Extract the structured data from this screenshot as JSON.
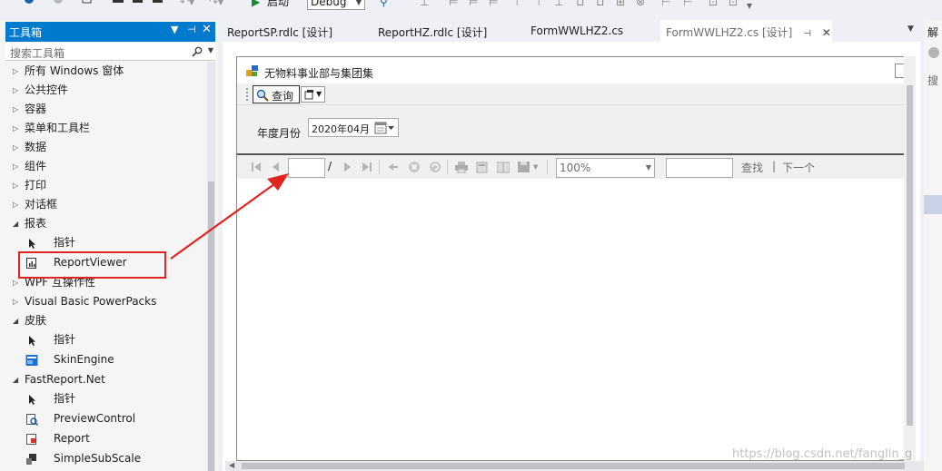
{
  "toolbar": {
    "start_label": "启动",
    "config_value": "Debug"
  },
  "toolbox": {
    "title": "工具箱",
    "search_placeholder": "搜索工具箱",
    "items": [
      {
        "label": "所有 Windows 窗体",
        "expander": "▷"
      },
      {
        "label": "公共控件",
        "expander": "▷"
      },
      {
        "label": "容器",
        "expander": "▷"
      },
      {
        "label": "菜单和工具栏",
        "expander": "▷"
      },
      {
        "label": "数据",
        "expander": "▷"
      },
      {
        "label": "组件",
        "expander": "▷"
      },
      {
        "label": "打印",
        "expander": "▷"
      },
      {
        "label": "对话框",
        "expander": "▷"
      },
      {
        "label": "报表",
        "expander": "◢"
      },
      {
        "label": "指针",
        "icon": "pointer-icon"
      },
      {
        "label": "ReportViewer",
        "icon": "report-viewer-icon"
      },
      {
        "label": "WPF 互操作性",
        "expander": "▷"
      },
      {
        "label": "Visual Basic PowerPacks",
        "expander": "▷"
      },
      {
        "label": "皮肤",
        "expander": "◢"
      },
      {
        "label": "指针",
        "icon": "pointer-icon"
      },
      {
        "label": "SkinEngine",
        "icon": "skin-engine-icon"
      },
      {
        "label": "FastReport.Net",
        "expander": "◢"
      },
      {
        "label": "指针",
        "icon": "pointer-icon"
      },
      {
        "label": "PreviewControl",
        "icon": "preview-control-icon"
      },
      {
        "label": "Report",
        "icon": "report-icon"
      },
      {
        "label": "SimpleSubScale",
        "icon": "simple-sub-scale-icon"
      }
    ]
  },
  "editor_tabs": [
    {
      "label": "ReportSP.rdlc [设计]"
    },
    {
      "label": "ReportHZ.rdlc [设计]"
    },
    {
      "label": "FormWWLHZ2.cs"
    },
    {
      "label": "FormWWLHZ2.cs [设计]"
    }
  ],
  "form": {
    "title": "无物料事业部与集团集",
    "query_label": "查询",
    "year_month_label": "年度月份",
    "date_value": "2020年04月"
  },
  "report_viewer": {
    "page_separator": "/",
    "zoom_value": "100%",
    "find_label": "查找",
    "find_separator": "|",
    "next_label": "下一个"
  },
  "right_panel": {
    "title": "解",
    "search": "搜"
  },
  "watermark": "https://blog.csdn.net/fanglin_g",
  "colors": {
    "accent": "#007acc",
    "highlight": "#e0241f"
  }
}
